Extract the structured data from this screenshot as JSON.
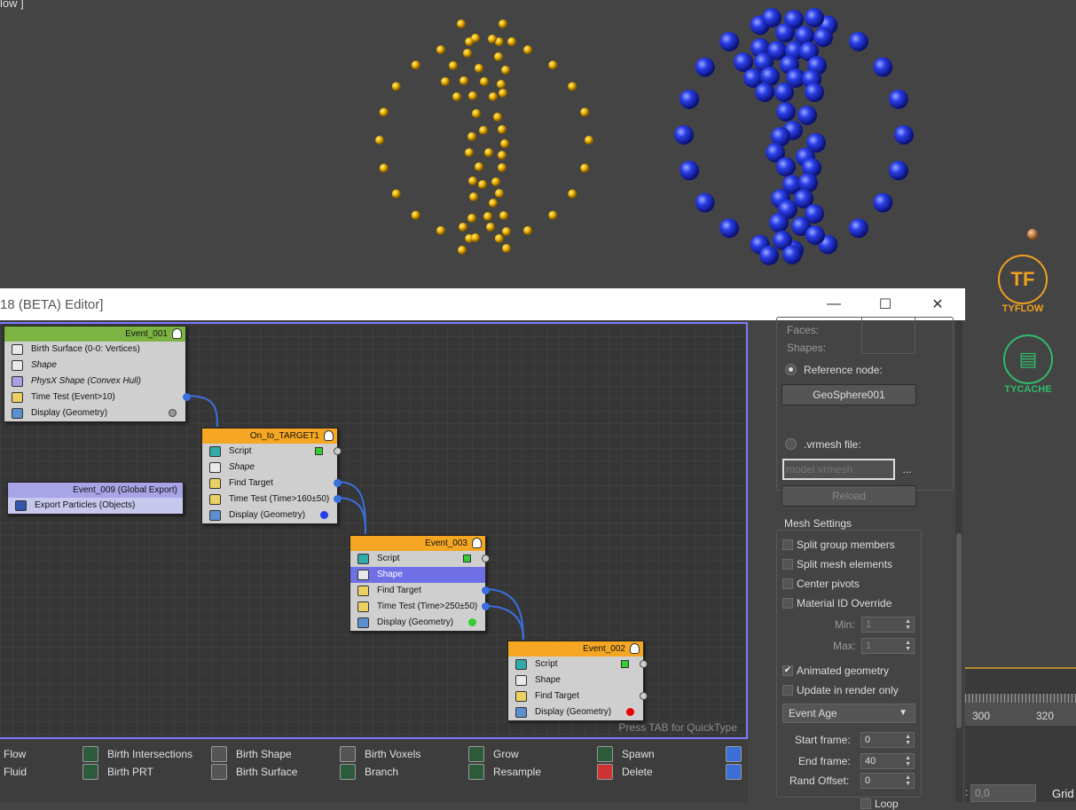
{
  "viewport": {
    "label": "low ]",
    "logos": {
      "tyflow": {
        "glyph": "TF",
        "text": "TYFLOW",
        "color": "#f0a020"
      },
      "tycache": {
        "glyph": "▤",
        "text": "TYCACHE",
        "color": "#2ebd6a"
      }
    },
    "ruler": [
      "300",
      "320"
    ],
    "coord_label": ":",
    "coord_value": "0,0",
    "grid_label": "Grid"
  },
  "editor": {
    "title": "18 (BETA) Editor]",
    "window_buttons": {
      "minimize": "—",
      "maximize": "☐",
      "close": "✕"
    },
    "quicktype_hint": "Press TAB for QuickType",
    "nodes": {
      "event_001": {
        "title": "Event_001",
        "color": "#7cb342",
        "ops": [
          "Birth Surface (0-0: Vertices)",
          "Shape",
          "PhysX Shape (Convex Hull)",
          "Time Test (Event>10)",
          "Display (Geometry)"
        ]
      },
      "on_to_target1": {
        "title": "On_to_TARGET1",
        "color": "#f5a623",
        "ops": [
          "Script",
          "Shape",
          "Find Target",
          "Time Test (Time>160±50)",
          "Display (Geometry)"
        ]
      },
      "event_009": {
        "title": "Event_009 (Global Export)",
        "color": "#a8a4e6",
        "ops": [
          "Export Particles (Objects)"
        ]
      },
      "event_003": {
        "title": "Event_003",
        "color": "#f5a623",
        "ops": [
          "Script",
          "Shape",
          "Find Target",
          "Time Test (Time>250±50)",
          "Display (Geometry)"
        ]
      },
      "event_002": {
        "title": "Event_002",
        "color": "#f5a623",
        "ops": [
          "Script",
          "Shape",
          "Find Target",
          "Display (Geometry)"
        ]
      }
    },
    "depot": [
      [
        "Flow",
        "Fluid"
      ],
      [
        "Birth Intersections",
        "Birth PRT"
      ],
      [
        "Birth Shape",
        "Birth Surface"
      ],
      [
        "Birth Voxels",
        "Branch"
      ],
      [
        "Grow",
        "Resample"
      ],
      [
        "Spawn",
        "Delete"
      ]
    ]
  },
  "panel": {
    "faces_label": "Faces:",
    "shapes_label": "Shapes:",
    "reference_node_label": "Reference node:",
    "reference_node_button": "GeoSphere001",
    "vrmesh_label": ".vrmesh file:",
    "vrmesh_placeholder": "model.vrmesh",
    "browse_button": "...",
    "reload_button": "Reload",
    "mesh_settings_title": "Mesh Settings",
    "split_group": "Split group members",
    "split_mesh": "Split mesh elements",
    "center_pivots": "Center pivots",
    "material_override": "Material ID Override",
    "min_label": "Min:",
    "min_value": "1",
    "max_label": "Max:",
    "max_value": "1",
    "animated_geometry": "Animated geometry",
    "update_render": "Update in render only",
    "event_age": "Event Age",
    "start_frame_label": "Start frame:",
    "start_frame_value": "0",
    "end_frame_label": "End frame:",
    "end_frame_value": "40",
    "rand_offset_label": "Rand Offset:",
    "rand_offset_value": "0",
    "loop_label": "Loop"
  }
}
